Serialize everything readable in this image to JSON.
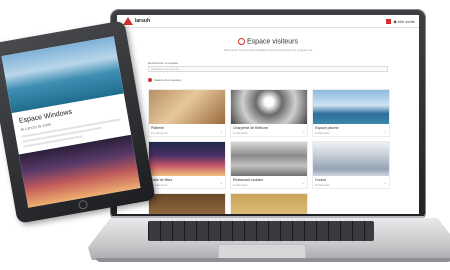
{
  "site": {
    "logo_text": "larsuh"
  },
  "header": {
    "nav_label": "◆ Allé sortie"
  },
  "page": {
    "title": "Espace visiteurs",
    "subtitle": "Découvrez l'univers des étudiants et professionnels du programme"
  },
  "search": {
    "label": "Rechercher un espace",
    "placeholder": "Saisissez un mot-clé..."
  },
  "section": {
    "label": "Galerie des espaces"
  },
  "cards": [
    {
      "title": "Plâtrerie",
      "count": "12 éléments"
    },
    {
      "title": "Charpente de Béthune",
      "count": "8 éléments"
    },
    {
      "title": "Espace piscine",
      "count": "6 éléments"
    },
    {
      "title": "Salle de fêtes",
      "count": "10 éléments"
    },
    {
      "title": "Restaurant scolaire",
      "count": "9 éléments"
    },
    {
      "title": "Couloir",
      "count": "5 éléments"
    },
    {
      "title": "",
      "count": ""
    },
    {
      "title": "",
      "count": ""
    }
  ],
  "tablet": {
    "title": "Espace Windows",
    "subtitle": "⊕ Lancer la visite"
  },
  "colors": {
    "accent": "#d0312d",
    "device_dark": "#1c1d20",
    "device_silver": "#c8cacc"
  },
  "icons": [
    "logo-triangle-icon",
    "menu-icon",
    "location-pin-icon",
    "chevron-down-icon"
  ]
}
